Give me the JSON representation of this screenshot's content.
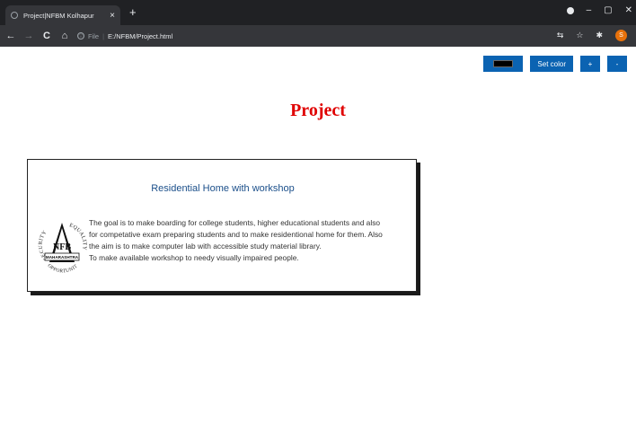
{
  "browser": {
    "tab_title": "Project|NFBM Kolhapur",
    "tab_close": "×",
    "new_tab": "+",
    "window_minimize": "–",
    "window_maximize": "▢",
    "window_close": "✕",
    "nav_back": "←",
    "nav_forward": "→",
    "nav_reload": "C",
    "nav_home": "⌂",
    "info": "ⓘ",
    "file_label": "File",
    "separator": "|",
    "url": "E:/NFBM/Project.html",
    "profile_initial": "S",
    "translate": "⇆",
    "bookmark": "☆",
    "extensions": "✱"
  },
  "controls": {
    "set_color_label": "Set color",
    "increase_label": "+",
    "decrease_label": "-",
    "swatch_color": "#000000"
  },
  "page": {
    "title": "Project"
  },
  "card": {
    "heading": "Residential Home with workshop",
    "lines": [
      "The goal is to make boarding for college students, higher educational students and also",
      "for competative exam preparing students and to make residentional home for them. Also",
      "the aim is to make computer lab with accessible study material library.",
      "To make available workshop to needy visually impaired people."
    ],
    "logo": {
      "ring_left": "SECURITY",
      "ring_right": "EQUALITY",
      "ring_bottom": "OPPORTUNITY",
      "center": "NFB",
      "banner": "MAHARASHTRA"
    }
  },
  "colors": {
    "accent_button": "#0b63b2",
    "title_red": "#e00000",
    "heading_blue": "#1b4f8a"
  }
}
